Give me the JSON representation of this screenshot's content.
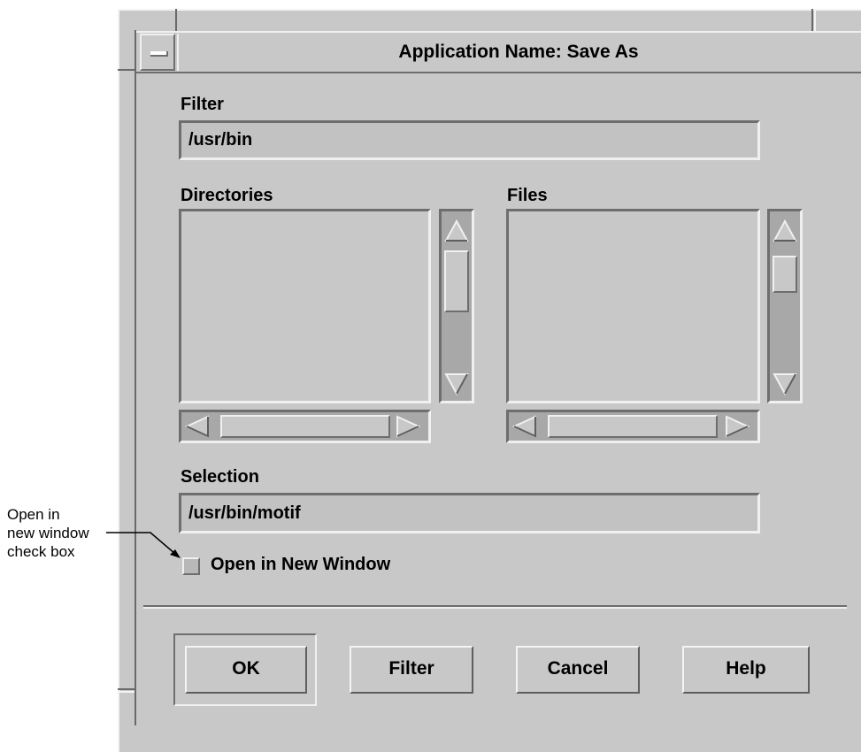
{
  "window": {
    "title": "Application Name: Save As"
  },
  "filter": {
    "label": "Filter",
    "value": "/usr/bin"
  },
  "directories": {
    "label": "Directories",
    "items": []
  },
  "files": {
    "label": "Files",
    "items": []
  },
  "selection": {
    "label": "Selection",
    "value": "/usr/bin/motif"
  },
  "open_new_window": {
    "label": "Open in New Window",
    "checked": false
  },
  "buttons": {
    "ok": "OK",
    "filter": "Filter",
    "cancel": "Cancel",
    "help": "Help"
  },
  "annotation": {
    "line1": "Open in",
    "line2": "new window",
    "line3": "check box"
  },
  "icons": {
    "window_menu": "window-menu-icon",
    "scroll_up": "triangle-up-icon",
    "scroll_down": "triangle-down-icon",
    "scroll_left": "triangle-left-icon",
    "scroll_right": "triangle-right-icon"
  }
}
